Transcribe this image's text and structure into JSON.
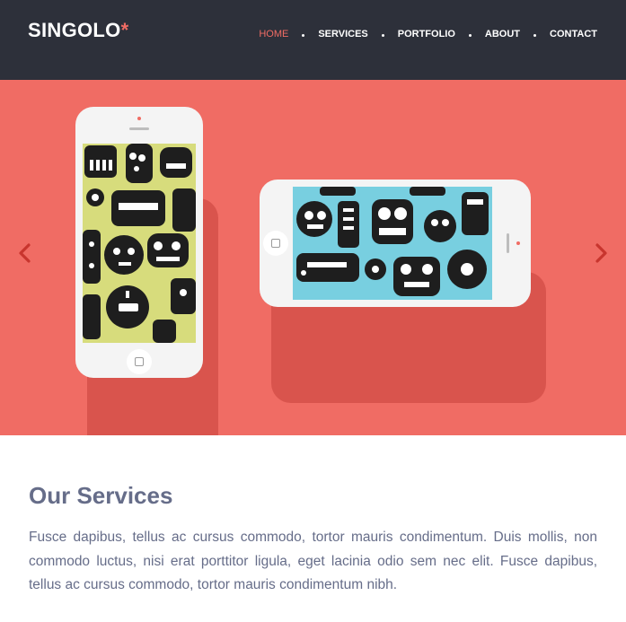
{
  "header": {
    "logo_text": "SINGOLO",
    "logo_accent": "*",
    "nav": [
      {
        "label": "HOME",
        "active": true
      },
      {
        "label": "SERVICES",
        "active": false
      },
      {
        "label": "PORTFOLIO",
        "active": false
      },
      {
        "label": "ABOUT",
        "active": false
      },
      {
        "label": "CONTACT",
        "active": false
      }
    ]
  },
  "slider": {
    "background_color": "#f06c64",
    "prev_icon": "chevron-left-icon",
    "next_icon": "chevron-right-icon",
    "phones": [
      {
        "orientation": "vertical",
        "screen_color": "#d7dc7c",
        "pattern": "robot-monsters"
      },
      {
        "orientation": "horizontal",
        "screen_color": "#78cfe0",
        "pattern": "robot-monsters"
      }
    ]
  },
  "services": {
    "title": "Our Services",
    "text": "Fusce dapibus, tellus ac cursus commodo, tortor mauris condimentum. Duis mollis, non commodo luctus, nisi erat porttitor ligula, eget lacinia odio sem nec elit. Fusce dapibus, tellus ac cursus commodo, tortor mauris condimentum nibh."
  },
  "colors": {
    "header_bg": "#2d303a",
    "accent": "#f06c64",
    "text": "#666d89"
  }
}
